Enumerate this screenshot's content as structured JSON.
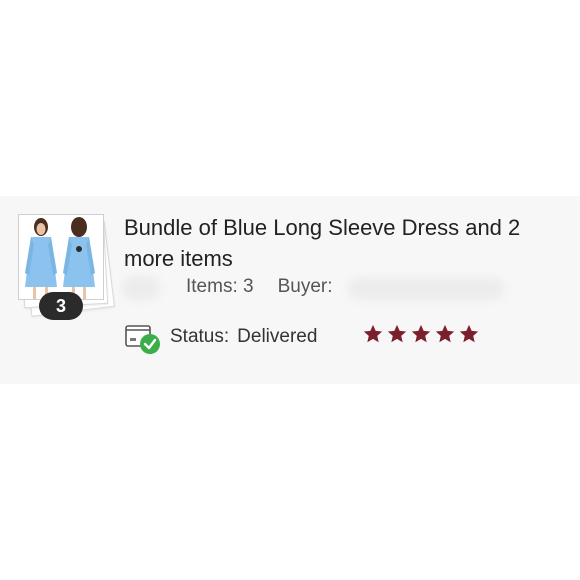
{
  "listing": {
    "title": "Bundle of Blue Long Sleeve Dress and 2 more items",
    "item_count_badge": "3",
    "items_text": "Items: 3",
    "buyer_label": "Buyer:",
    "status_label": "Status:",
    "status_value": "Delivered",
    "rating_stars": 5,
    "rating_max": 5
  },
  "icons": [
    "package-delivered-icon",
    "star-icon"
  ],
  "colors": {
    "card_bg": "#f7f7f7",
    "dress_blue": "#8cc3ee",
    "check_green": "#3cad49",
    "star_maroon": "#7a1f2b",
    "badge_bg": "#2b2b2b"
  }
}
